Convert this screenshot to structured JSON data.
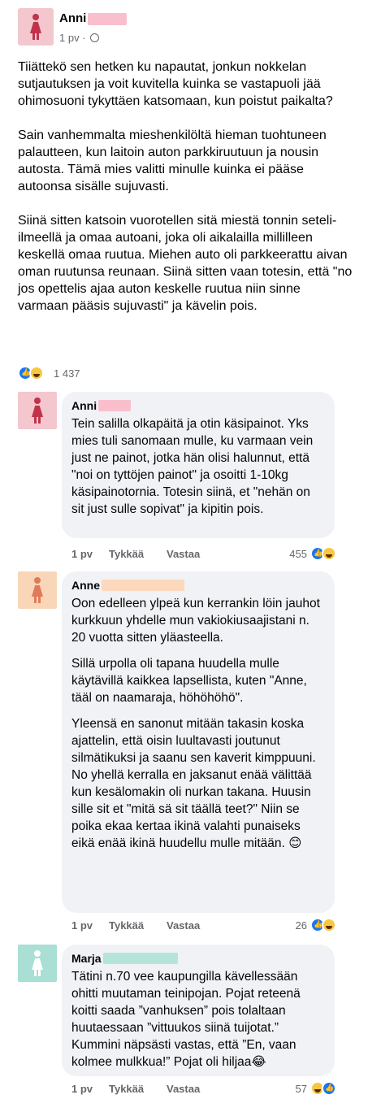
{
  "post": {
    "author": "Anni",
    "time": "1 pv",
    "paragraphs": [
      "Tiiättekö sen hetken ku napautat, jonkun nokkelan sutjautuksen ja voit kuvitella kuinka se vastapuoli jää ohimosuoni tykyttäen katsomaan, kun poistut paikalta?",
      "Sain vanhemmalta mieshenkilöltä hieman tuohtuneen palautteen, kun laitoin auton parkkiruutuun ja nousin autosta. Tämä mies valitti minulle kuinka ei pääse autoonsa sisälle sujuvasti.",
      "Siinä sitten katsoin vuorotellen sitä miestä tonnin seteli-ilmeellä ja omaa autoani, joka oli aikalailla millilleen keskellä omaa ruutua. Miehen auto oli parkkeerattu aivan oman ruutunsa reunaan. Siinä sitten vaan totesin, että \"no jos opettelis ajaa auton keskelle ruutua niin sinne varmaan pääsis sujuvasti\" ja kävelin pois."
    ],
    "reaction_count": "1 437",
    "reactions": [
      "like",
      "haha"
    ]
  },
  "actions": {
    "time": "1 pv",
    "like": "Tykkää",
    "reply": "Vastaa"
  },
  "comments": [
    {
      "author": "Anni",
      "paragraphs": [
        "Tein salilla olkapäitä ja otin käsipainot. Yks mies tuli sanomaan mulle, ku varmaan vein just ne painot, jotka hän olisi halunnut, että \"noi on tyttöjen painot\" ja osoitti 1-10kg käsipainotornia. Totesin siinä, et \"nehän on sit just sulle sopivat\" ja kipitin pois."
      ],
      "reaction_count": "455",
      "avatar_color": "#f4c7cf",
      "figure_color": "#c0334a",
      "redact_color": "#f9bfcd"
    },
    {
      "author": "Anne",
      "paragraphs": [
        "Oon edelleen ylpeä kun kerrankin löin jauhot kurkkuun yhdelle mun vakiokiusaajistani n. 20 vuotta sitten yläasteella.",
        "Sillä urpolla oli tapana huudella mulle käytävillä kaikkea lapsellista, kuten \"Anne, tääl on naamaraja, höhöhöhö\".",
        "Yleensä en sanonut mitään takasin koska ajattelin, että oisin luultavasti joutunut silmätikuksi ja saanu sen kaverit kimppuuni. No yhellä kerralla en jaksanut enää välittää kun kesälomakin oli nurkan takana. Huusin sille sit et \"mitä sä sit täällä teet?\" Niin se poika ekaa kertaa ikinä valahti punaiseks eikä enää ikinä huudellu mulle mitään. 😊"
      ],
      "reaction_count": "26",
      "avatar_color": "#fad6b8",
      "figure_color": "#e07a5a",
      "redact_color": "#fcd9bd"
    },
    {
      "author": "Marja",
      "paragraphs": [
        "Tätini n.70 vee kaupungilla kävellessään ohitti muutaman teinipojan. Pojat reteenä koitti saada ”vanhuksen” pois tolaltaan huutaessaan ”vittuukos siinä tuijotat.” Kummini näpsästi vastas, että ”En, vaan kolmee mulkkua!” Pojat oli hiljaa😂"
      ],
      "reaction_count": "57",
      "avatar_color": "#a9dfd4",
      "figure_color": "#ffffff",
      "redact_color": "#b5e4da"
    }
  ]
}
